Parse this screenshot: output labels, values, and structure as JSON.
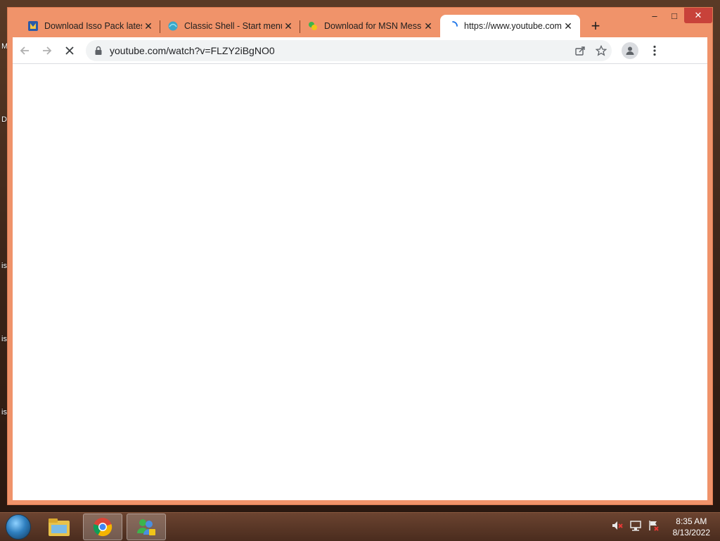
{
  "desktop": {
    "labels": [
      "M",
      "D",
      "is",
      "is",
      "is"
    ]
  },
  "window": {
    "caption": {
      "minimize": "–",
      "maximize": "□",
      "close": "✕"
    },
    "tabs": [
      {
        "title": "Download Isso Pack lates",
        "favicon": "isso-pack-favicon",
        "close": "✕",
        "active": false
      },
      {
        "title": "Classic Shell - Start menu",
        "favicon": "classic-shell-favicon",
        "close": "✕",
        "active": false
      },
      {
        "title": "Download for MSN Mess",
        "favicon": "msn-favicon",
        "close": "✕",
        "active": false
      },
      {
        "title": "https://www.youtube.com",
        "favicon": "loading-spinner-icon",
        "close": "✕",
        "active": true
      }
    ],
    "new_tab": "+",
    "toolbar": {
      "url": "youtube.com/watch?v=FLZY2iBgNO0"
    }
  },
  "taskbar": {
    "clock": {
      "time": "8:35 AM",
      "date": "8/13/2022"
    },
    "tray_icons": [
      "speaker-muted-icon",
      "network-icon",
      "action-center-flag-icon"
    ],
    "pinned": [
      "file-explorer-icon",
      "chrome-icon",
      "messenger-icon"
    ]
  },
  "colors": {
    "frame": "#f0936a",
    "close_button": "#c8423a",
    "omnibox": "#f1f3f4"
  }
}
